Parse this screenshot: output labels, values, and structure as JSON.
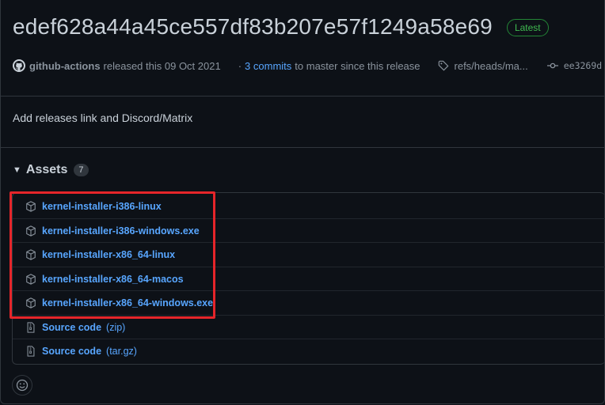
{
  "release": {
    "title": "edef628a44a45ce557df83b207e57f1249a58e69",
    "latest_badge": "Latest",
    "author": "github-actions",
    "released_text": "released this 09 Oct 2021",
    "commits_prefix": "·",
    "commits_link": "3 commits",
    "commits_suffix": "to master since this release",
    "ref": "refs/heads/ma...",
    "commit_sha": "ee3269d",
    "description": "Add releases link and Discord/Matrix"
  },
  "assets": {
    "label": "Assets",
    "count": "7",
    "items": [
      {
        "name": "kernel-installer-i386-linux"
      },
      {
        "name": "kernel-installer-i386-windows.exe"
      },
      {
        "name": "kernel-installer-x86_64-linux"
      },
      {
        "name": "kernel-installer-x86_64-macos"
      },
      {
        "name": "kernel-installer-x86_64-windows.exe"
      }
    ],
    "sources": [
      {
        "name": "Source code",
        "ext": "(zip)"
      },
      {
        "name": "Source code",
        "ext": "(tar.gz)"
      }
    ]
  },
  "colors": {
    "background": "#0d1117",
    "link": "#58a6ff",
    "latest_green": "#3fb950",
    "highlight_red": "#e5252a"
  },
  "icons": [
    "github-avatar-icon",
    "tag-icon",
    "commit-icon",
    "check-circle-icon",
    "package-icon",
    "file-zip-icon",
    "smiley-icon"
  ]
}
